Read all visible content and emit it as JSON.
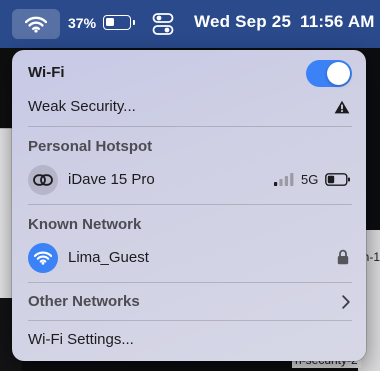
{
  "menubar": {
    "battery_percent": "37%",
    "battery_level": 0.37,
    "date": "Wed Sep 25",
    "time": "11:56 AM"
  },
  "wifi_panel": {
    "title": "Wi-Fi",
    "toggle_on": true,
    "weak_security_label": "Weak Security...",
    "personal_hotspot_header": "Personal Hotspot",
    "hotspot": {
      "name": "iDave 15 Pro",
      "network_type": "5G",
      "signal_bars": 1
    },
    "known_network_header": "Known Network",
    "known_network": {
      "name": "Lima_Guest",
      "locked": true
    },
    "other_networks_label": "Other Networks",
    "settings_label": "Wi-Fi Settings..."
  },
  "background": {
    "right_text": "n-1",
    "bottom_text": "n-security-2"
  },
  "colors": {
    "menubar": "#2a4a8c",
    "accent": "#3a82f6"
  }
}
